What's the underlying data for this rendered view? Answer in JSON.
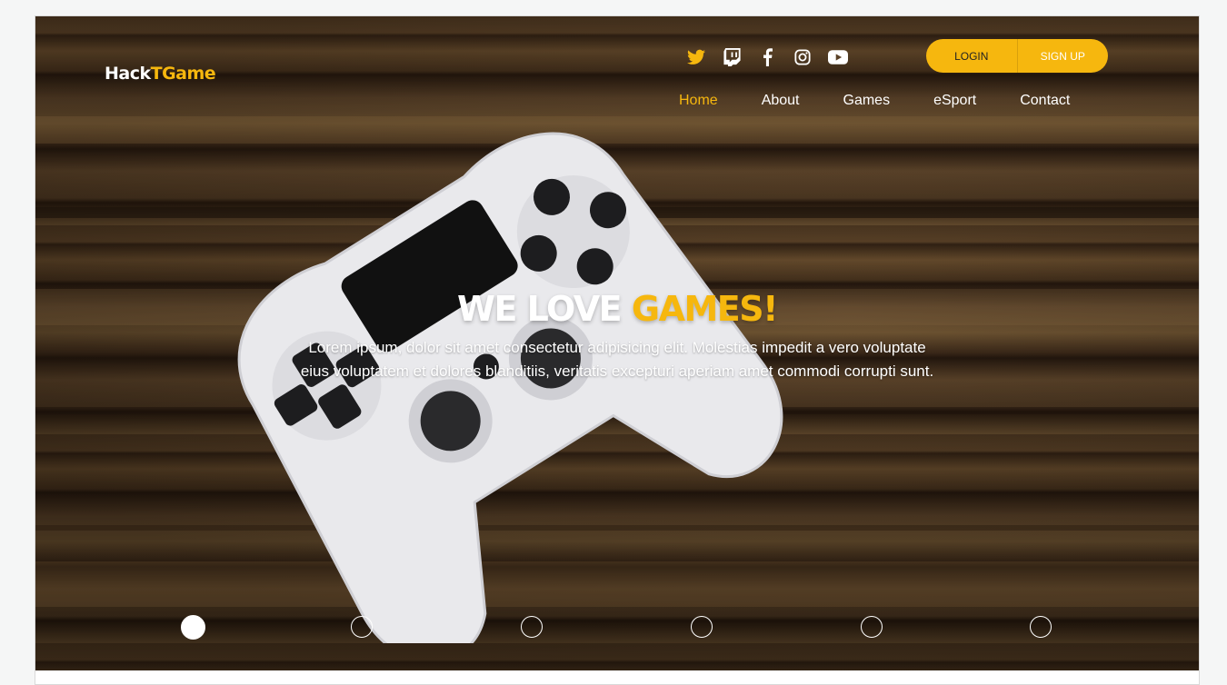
{
  "brand": {
    "logo_main": "Hack",
    "logo_accent": "TGame"
  },
  "colors": {
    "accent": "#f6b70e",
    "text": "#ffffff"
  },
  "socials": [
    {
      "icon": "twitter-icon",
      "color": "#f6b70e"
    },
    {
      "icon": "twitch-icon",
      "color": "#ffffff"
    },
    {
      "icon": "facebook-icon",
      "color": "#ffffff"
    },
    {
      "icon": "instagram-icon",
      "color": "#ffffff"
    },
    {
      "icon": "youtube-icon",
      "color": "#ffffff"
    }
  ],
  "auth": {
    "login": "LOGIN",
    "signup": "SIGN UP"
  },
  "nav": {
    "items": [
      {
        "label": "Home",
        "active": true
      },
      {
        "label": "About",
        "active": false
      },
      {
        "label": "Games",
        "active": false
      },
      {
        "label": "eSport",
        "active": false
      },
      {
        "label": "Contact",
        "active": false
      }
    ]
  },
  "hero": {
    "title_main": "WE LOVE ",
    "title_accent": "GAMES!",
    "subtitle": "Lorem ipsum, dolor sit amet consectetur adipisicing elit. Molestias impedit a vero voluptate eius voluptatem et dolores blanditiis, veritatis excepturi aperiam amet commodi corrupti sunt.",
    "image": "white-game-controller-on-wooden-table"
  },
  "slider": {
    "count": 6,
    "active_index": 0
  }
}
